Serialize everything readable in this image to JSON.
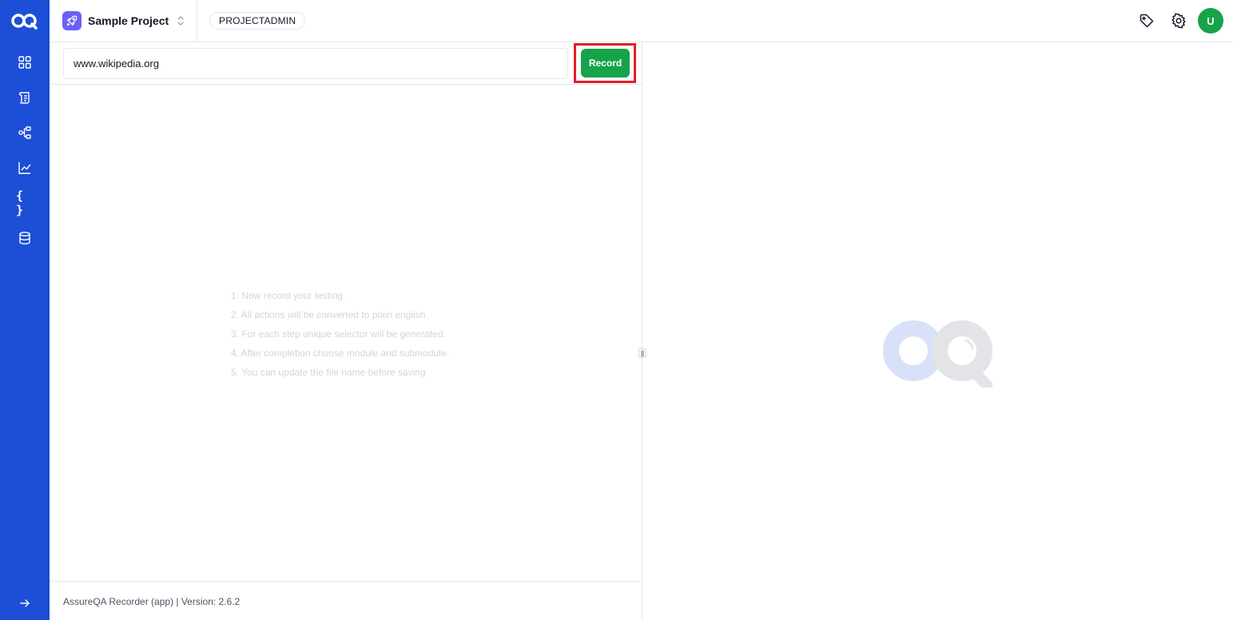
{
  "sidebar": {
    "logo": "aq-logo",
    "items": [
      {
        "icon": "dashboard-grid-icon"
      },
      {
        "icon": "scroll-icon"
      },
      {
        "icon": "workflow-icon"
      },
      {
        "icon": "chart-line-icon"
      },
      {
        "icon": "braces-icon",
        "glyph": "{ }"
      },
      {
        "icon": "database-icon"
      }
    ],
    "expand_icon": "arrow-right-icon"
  },
  "header": {
    "project_name": "Sample Project",
    "role": "PROJECTADMIN",
    "avatar_initial": "U",
    "icons": [
      "tag-icon",
      "gear-icon"
    ]
  },
  "recorder": {
    "url_value": "www.wikipedia.org",
    "record_label": "Record",
    "instructions": [
      "1. Now record your testing.",
      "2. All actions will be converted to plain english.",
      "3. For each step unique selector will be generated.",
      "4. After completion choose module and submodule.",
      "5. You can update the file name before saving"
    ],
    "footer": "AssureQA Recorder (app) | Version: 2.6.2"
  },
  "colors": {
    "sidebar": "#1d4ed8",
    "record_button": "#16a34a",
    "highlight": "#e11d28",
    "project_icon": "#6d5ef5",
    "avatar": "#16a34a"
  }
}
